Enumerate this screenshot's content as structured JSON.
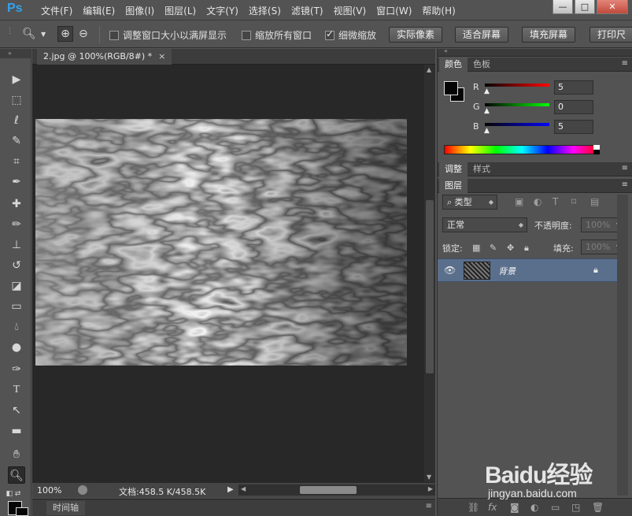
{
  "app": {
    "logo": "Ps"
  },
  "menu": [
    "文件(F)",
    "编辑(E)",
    "图像(I)",
    "图层(L)",
    "文字(Y)",
    "选择(S)",
    "滤镜(T)",
    "视图(V)",
    "窗口(W)",
    "帮助(H)"
  ],
  "window_controls": {
    "minimize": "—",
    "maximize": "□",
    "close": "✕"
  },
  "options": {
    "resize_windows_label": "调整窗口大小以满屏显示",
    "resize_windows_checked": false,
    "zoom_all_label": "缩放所有窗口",
    "zoom_all_checked": false,
    "scrubby_zoom_label": "细微缩放",
    "scrubby_zoom_checked": true,
    "actual_pixels": "实际像素",
    "fit_screen": "适合屏幕",
    "fill_screen": "填充屏幕",
    "print_size": "打印尺"
  },
  "document": {
    "tab_title": "2.jpg @ 100%(RGB/8#) *",
    "tab_close": "×",
    "zoom": "100%",
    "doc_info": "文档:458.5 K/458.5K"
  },
  "timeline": {
    "tab": "时间轴"
  },
  "color_panel": {
    "tab_color": "颜色",
    "tab_swatches": "色板",
    "r_label": "R",
    "r_value": "5",
    "g_label": "G",
    "g_value": "0",
    "b_label": "B",
    "b_value": "5",
    "foreground": "#050505",
    "background": "#050505"
  },
  "adjust_panel": {
    "tab_adjust": "调整",
    "tab_styles": "样式"
  },
  "layers_panel": {
    "tab": "图层",
    "filter_kind": "类型",
    "blend_mode": "正常",
    "opacity_label": "不透明度:",
    "opacity_value": "100%",
    "lock_label": "锁定:",
    "fill_label": "填充:",
    "fill_value": "100%",
    "layer_name": "背景"
  },
  "watermark": {
    "brand": "Baidu经验",
    "url": "jingyan.baidu.com"
  }
}
